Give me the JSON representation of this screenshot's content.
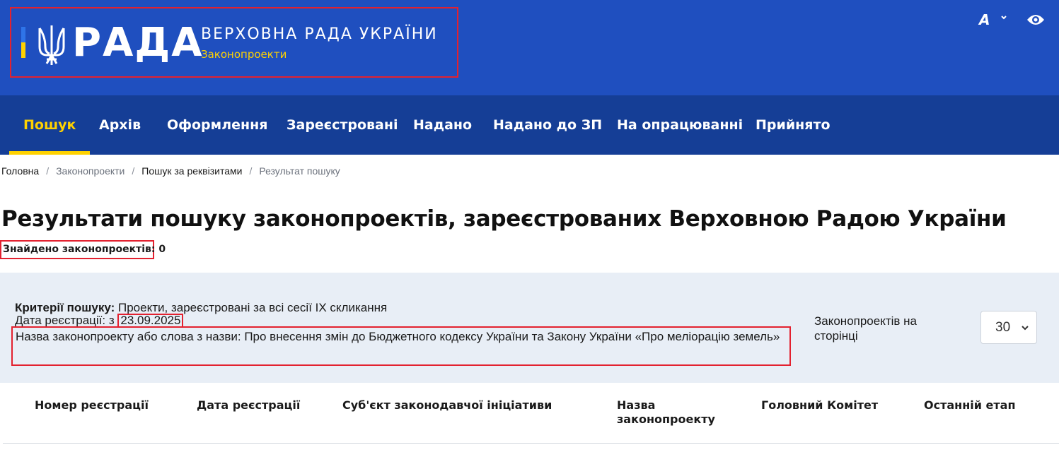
{
  "header": {
    "logo_word": "РАДА",
    "site_title": "ВЕРХОВНА РАДА УКРАЇНИ",
    "section_title": "Законопроекти",
    "font_toggle_label": "A",
    "colors": {
      "header_bg": "#1f4fbf",
      "nav_bg": "#153e96",
      "accent": "#ffd200",
      "highlight": "#e3212f"
    }
  },
  "nav": {
    "items": [
      {
        "label": "Пошук",
        "active": true
      },
      {
        "label": "Архів"
      },
      {
        "label": "Оформлення"
      },
      {
        "label": "Зареєстровані"
      },
      {
        "label": "Надано"
      },
      {
        "label": "Надано до ЗП"
      },
      {
        "label": "На опрацюванні"
      },
      {
        "label": "Прийнято"
      }
    ]
  },
  "breadcrumb": [
    {
      "label": "Головна"
    },
    {
      "label": "Законопроекти"
    },
    {
      "label": "Пошук за реквізитами"
    },
    {
      "label": "Результат пошуку"
    }
  ],
  "page": {
    "title": "Результати пошуку законопроектів, зареєстрованих Верховною Радою України",
    "found_label": "Знайдено законопроектів: 0"
  },
  "criteria": {
    "label": "Критерії пошуку:",
    "value": " Проекти, зареєстровані за всі сесії IX скликання",
    "reg_date_label": "Дата реєстрації: з ",
    "reg_date_value": "23.09.2025",
    "name_line": "Назва законопроекту або слова з назви: Про внесення змін до Бюджетного кодексу України та Закону України «Про меліорацію земель»",
    "per_page_label": "Законопроектів на сторінці",
    "per_page_value": "30"
  },
  "table": {
    "columns": [
      "Номер реєстрації",
      "Дата реєстрації",
      "Суб'єкт законодавчої ініціативи",
      "Назва законопроекту",
      "Головний Комітет",
      "Останній етап"
    ]
  }
}
